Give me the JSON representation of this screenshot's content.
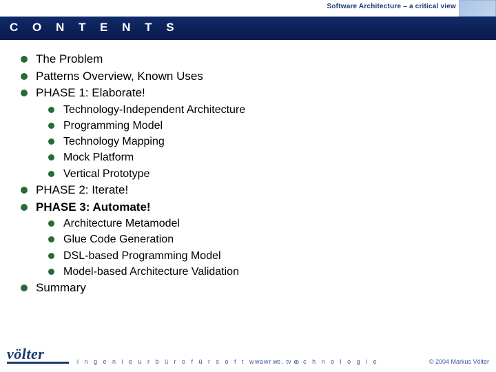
{
  "header": {
    "title": "Software Architecture – a critical view"
  },
  "slide": {
    "heading": "C O N T E N T S"
  },
  "contents": {
    "items": [
      {
        "label": "The Problem"
      },
      {
        "label": "Patterns Overview, Known Uses"
      },
      {
        "label": "PHASE 1: Elaborate!",
        "sub": [
          "Technology-Independent Architecture",
          "Programming Model",
          "Technology Mapping",
          "Mock Platform",
          "Vertical Prototype"
        ]
      },
      {
        "label": "PHASE 2: Iterate!"
      },
      {
        "label": "PHASE 3: Automate!",
        "bold": true,
        "sub": [
          "Architecture Metamodel",
          "Glue Code Generation",
          "DSL-based Programming Model",
          "Model-based Architecture Validation"
        ]
      },
      {
        "label": "Summary"
      }
    ]
  },
  "footer": {
    "logo": "völter",
    "tagline": "i n g e n i e u r b ü r o   f ü r   s o f t w a r e t e c h n o l o g i e",
    "url": "w w w . v o",
    "copyright": "© 2004  Markus Völter"
  }
}
